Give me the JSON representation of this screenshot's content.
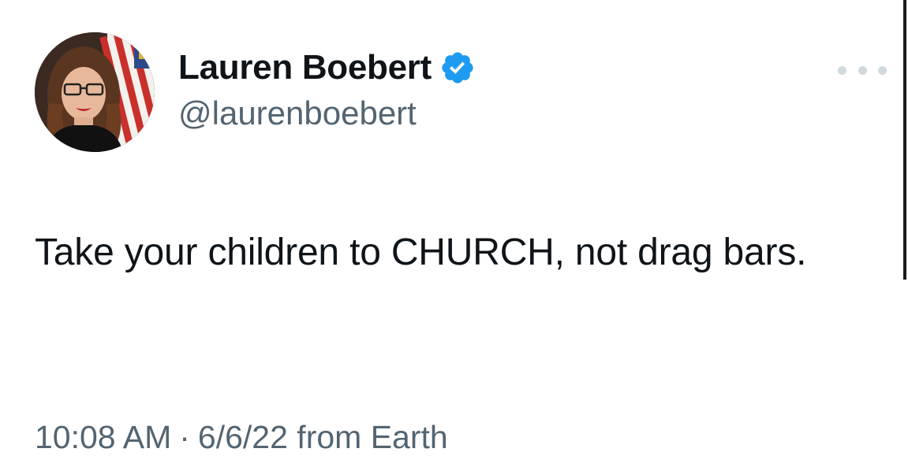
{
  "author": {
    "display_name": "Lauren Boebert",
    "handle": "@laurenboebert",
    "verified_icon": "verified-badge-icon",
    "verified_color": "#1d9bf0"
  },
  "tweet": {
    "text": "Take your children to CHURCH, not drag bars."
  },
  "meta": {
    "time": "10:08 AM",
    "separator": "·",
    "date": "6/6/22",
    "source": "from Earth"
  },
  "menu": {
    "icon": "more-options-icon"
  }
}
